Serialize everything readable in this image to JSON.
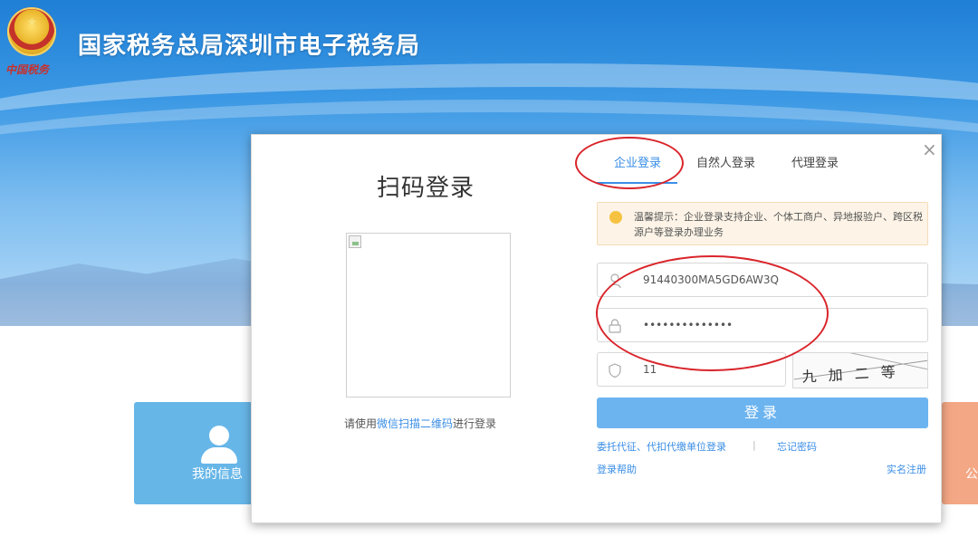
{
  "header": {
    "title": "国家税务总局深圳市电子税务局",
    "logo_script": "中国税务"
  },
  "background_cards": {
    "left_label": "我的信息",
    "right_label": "公"
  },
  "modal": {
    "close_glyph": "×",
    "qr": {
      "title": "扫码登录",
      "hint_prefix": "请使用",
      "hint_link": "微信扫描二维码",
      "hint_suffix": "进行登录"
    },
    "tabs": [
      {
        "label": "企业登录",
        "active": true
      },
      {
        "label": "自然人登录",
        "active": false
      },
      {
        "label": "代理登录",
        "active": false
      }
    ],
    "notice": "温馨提示：企业登录支持企业、个体工商户、异地报验户、跨区税源户等登录办理业务",
    "fields": {
      "tax_id": "91440300MA5GD6AW3Q",
      "password": "••••••••••••••",
      "captcha": "11"
    },
    "captcha_text": "九 加 二 等于？",
    "login_label": "登录",
    "links": {
      "delegate": "委托代征、代扣代缴单位登录",
      "separator": "|",
      "forgot": "忘记密码",
      "help": "登录帮助",
      "register": "实名注册"
    }
  },
  "colors": {
    "accent": "#3a8ee6",
    "annotation": "#d9252b",
    "login_button": "#6cb4f0"
  }
}
